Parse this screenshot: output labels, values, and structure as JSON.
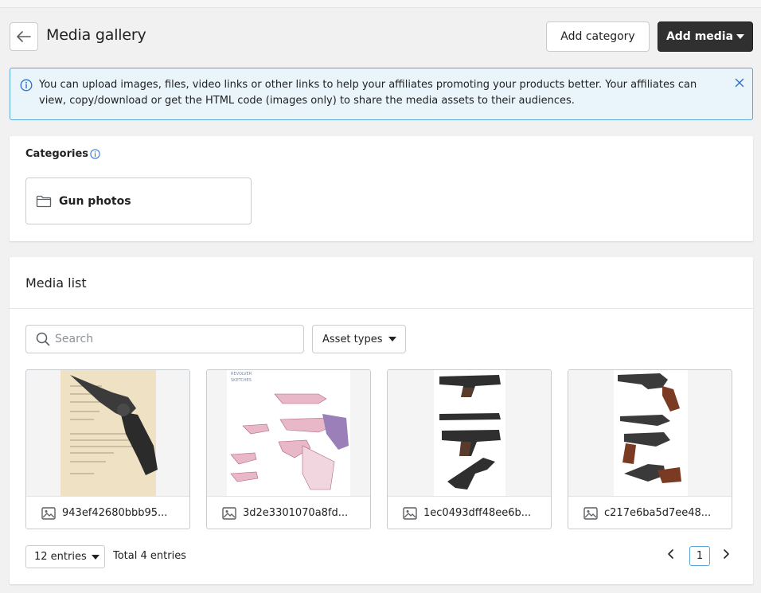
{
  "header": {
    "title": "Media gallery",
    "add_category_label": "Add category",
    "add_media_label": "Add media"
  },
  "banner": {
    "text": "You can upload images, files, video links or other links to help your affiliates promoting your products better. Your affiliates can view, copy/download or get the HTML code (images only) to share the media assets to their audiences."
  },
  "categories": {
    "title": "Categories",
    "items": [
      {
        "label": "Gun photos",
        "icon": "folder-icon"
      }
    ]
  },
  "media": {
    "title": "Media list",
    "search_placeholder": "Search",
    "asset_types_label": "Asset types",
    "items": [
      {
        "name": "943ef42680bbb95...",
        "icon": "image-icon"
      },
      {
        "name": "3d2e3301070a8fd...",
        "icon": "image-icon"
      },
      {
        "name": "1ec0493dff48ee6b...",
        "icon": "image-icon"
      },
      {
        "name": "c217e6ba5d7ee48...",
        "icon": "image-icon"
      }
    ]
  },
  "pagination": {
    "entries_label": "12 entries",
    "total_label": "Total 4 entries",
    "current_page": "1"
  },
  "colors": {
    "primary_button": "#303030",
    "banner_bg": "#eaf4fb",
    "banner_border": "#5aa6d6"
  }
}
